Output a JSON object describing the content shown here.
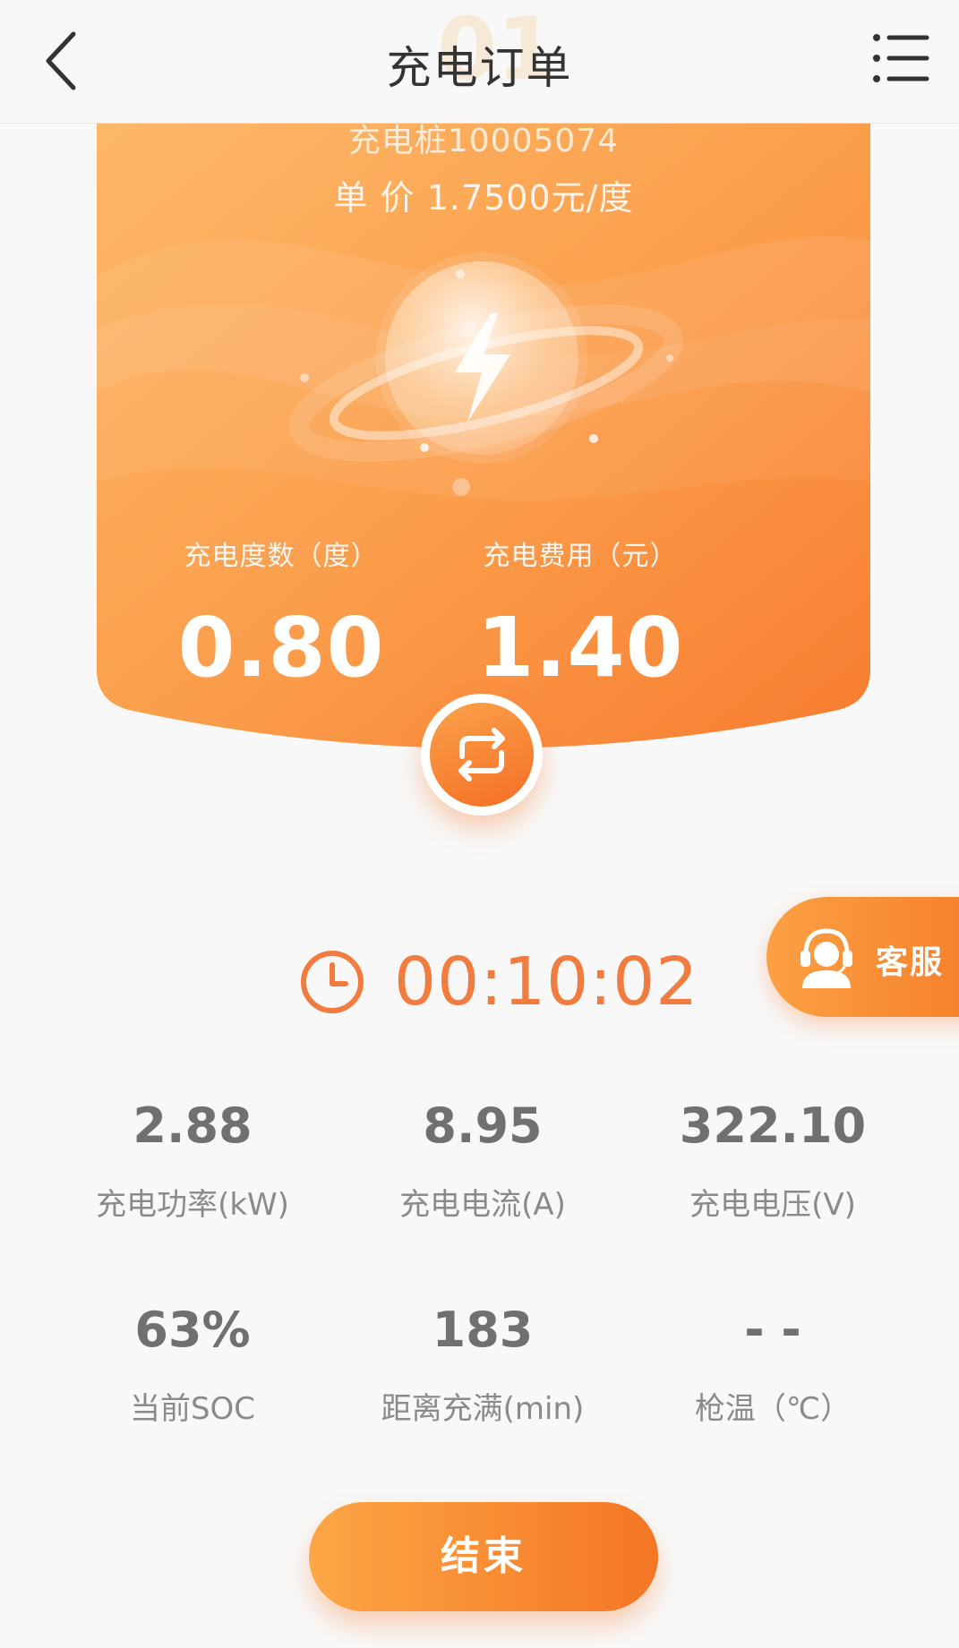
{
  "header": {
    "title": "充电订单",
    "ghost_number": "01",
    "back_icon": "chevron-left-icon",
    "menu_icon": "list-menu-icon"
  },
  "card": {
    "pile_no": "充电桩10005074",
    "unit_price": "单 价 1.7500元/度",
    "energy_label": "充电度数（度）",
    "energy_value": "0.80",
    "cost_label": "充电费用（元）",
    "cost_value": "1.40",
    "illustration_icon": "lightning-planet-icon",
    "refresh_icon": "refresh-cycle-icon"
  },
  "service": {
    "label": "客服",
    "icon": "headset-agent-icon"
  },
  "timer": {
    "icon": "clock-icon",
    "elapsed": "00:10:02"
  },
  "metrics": [
    {
      "value": "2.88",
      "label": "充电功率(kW)"
    },
    {
      "value": "8.95",
      "label": "充电电流(A)"
    },
    {
      "value": "322.10",
      "label": "充电电压(V)"
    },
    {
      "value": "63%",
      "label": "当前SOC"
    },
    {
      "value": "183",
      "label": "距离充满(min)"
    },
    {
      "value": "- -",
      "label": "枪温（℃）"
    }
  ],
  "actions": {
    "end_label": "结束"
  },
  "colors": {
    "accent": "#f7862f",
    "accent_light": "#fca646",
    "timer_text": "#f27b3f",
    "metric_value": "#707070",
    "metric_label": "#8a8a8a",
    "background": "#f8f8f8"
  }
}
